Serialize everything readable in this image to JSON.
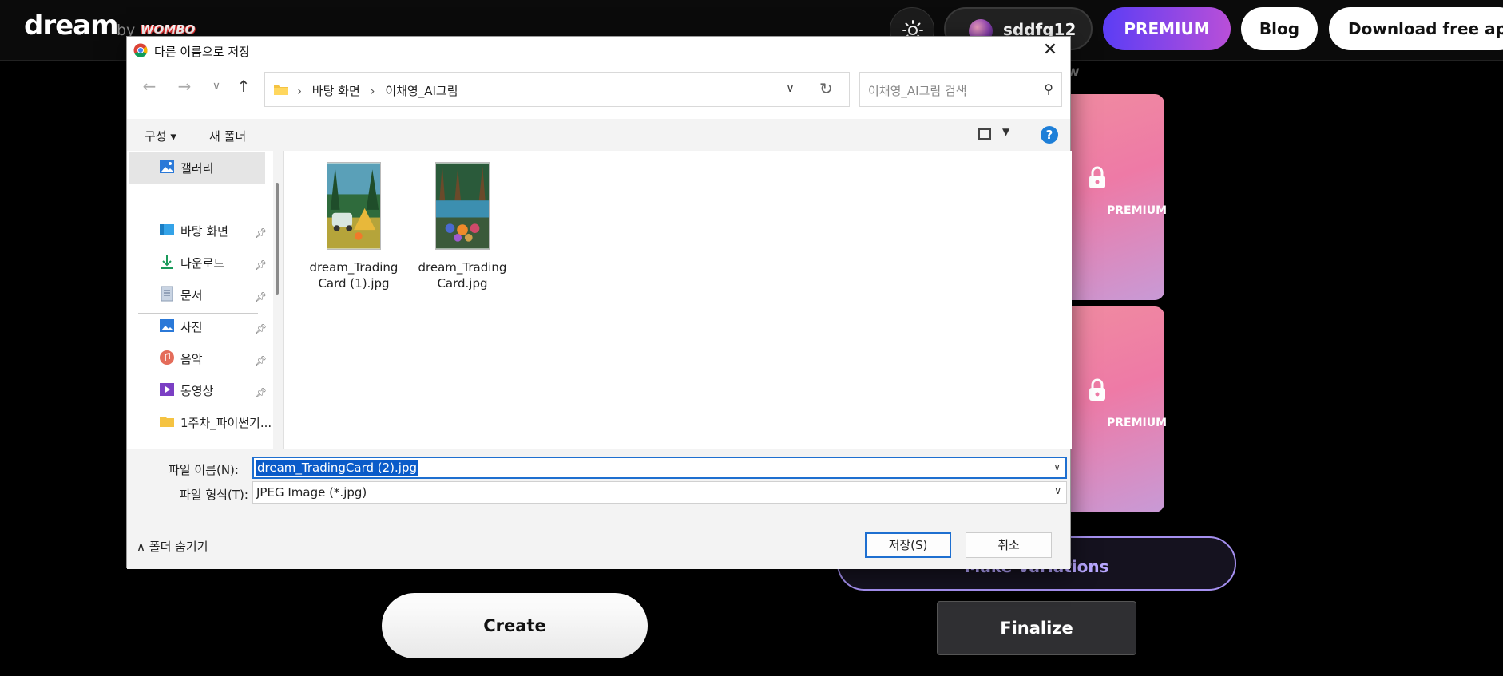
{
  "site": {
    "logo": "dream",
    "by": "by",
    "wombo": "WOMBO",
    "user_name": "sddfg12",
    "premium": "PREMIUM",
    "blog": "Blog",
    "download": "Download free app",
    "partial_top_text": "w"
  },
  "page": {
    "cards": [
      {
        "label": "PREMIUM"
      },
      {
        "label": "PREMIUM"
      }
    ],
    "variations_label": "Make Variations",
    "create_label": "Create",
    "finalize_label": "Finalize"
  },
  "dialog": {
    "title": "다른 이름으로 저장",
    "breadcrumbs": [
      "바탕 화면",
      "이채영_AI그림"
    ],
    "search_placeholder": "이채영_AI그림 검색",
    "organize": "구성",
    "new_folder": "새 폴더",
    "sidebar": [
      {
        "label": "갤러리",
        "icon": "gallery-icon",
        "pinned": false
      },
      {
        "label": "바탕 화면",
        "icon": "desktop-icon",
        "pinned": true
      },
      {
        "label": "다운로드",
        "icon": "download-icon",
        "pinned": true
      },
      {
        "label": "문서",
        "icon": "document-icon",
        "pinned": true
      },
      {
        "label": "사진",
        "icon": "pictures-icon",
        "pinned": true
      },
      {
        "label": "음악",
        "icon": "music-icon",
        "pinned": true
      },
      {
        "label": "동영상",
        "icon": "video-icon",
        "pinned": true
      },
      {
        "label": "1주차_파이썬기...",
        "icon": "folder-icon",
        "pinned": false
      }
    ],
    "files": [
      {
        "name": "dream_TradingCard (1).jpg"
      },
      {
        "name": "dream_TradingCard.jpg"
      }
    ],
    "filename_label": "파일 이름(N):",
    "filename_value": "dream_TradingCard (2).jpg",
    "filetype_label": "파일 형식(T):",
    "filetype_value": "JPEG Image (*.jpg)",
    "hide_folders": "폴더 숨기기",
    "save": "저장(S)",
    "cancel": "취소"
  },
  "colors": {
    "accent": "#1e6fd0",
    "premium_gradient_start": "#5b3df5",
    "premium_gradient_end": "#b94fd8",
    "card_pink": "#ee7aa6"
  }
}
